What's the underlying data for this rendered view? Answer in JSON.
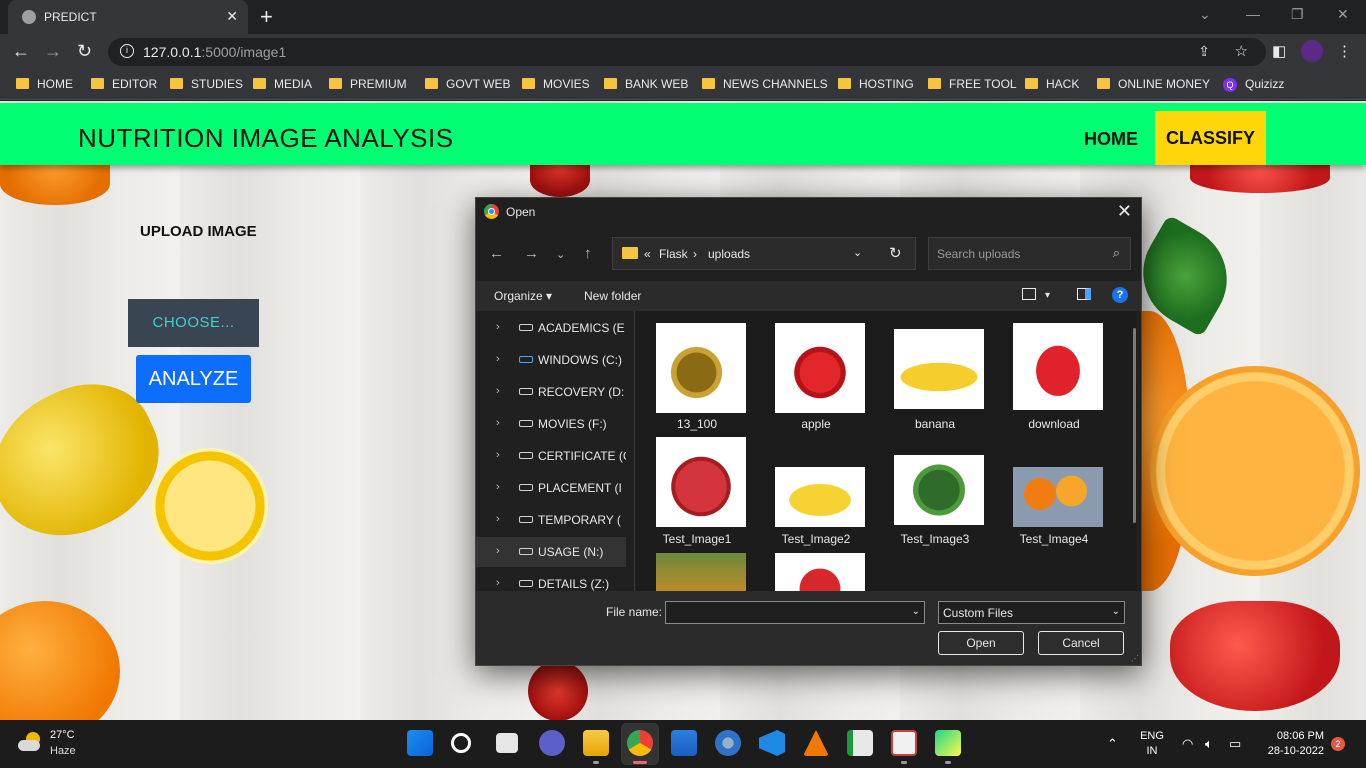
{
  "browser": {
    "tab_title": "PREDICT",
    "tab_close": "✕",
    "new_tab": "+",
    "url_host": "127.0.0.1",
    "url_path": ":5000/image1",
    "info_glyph": "i",
    "bookmarks": [
      "HOME",
      "EDITOR",
      "STUDIES",
      "MEDIA",
      "PREMIUM",
      "GOVT WEB",
      "MOVIES",
      "BANK WEB",
      "NEWS CHANNELS",
      "HOSTING",
      "FREE TOOL",
      "HACK",
      "ONLINE MONEY",
      "Quizizz"
    ],
    "quizizz_glyph": "Q"
  },
  "page": {
    "brand": "NUTRITION IMAGE ANALYSIS",
    "nav_home": "HOME",
    "nav_classify": "CLASSIFY",
    "nav_classify_color": "#ffd60a",
    "navbar_color": "#00ff73",
    "upload_label": "UPLOAD IMAGE",
    "choose_label": "CHOOSE...",
    "analyze_label": "ANALYZE"
  },
  "dialog": {
    "title": "Open",
    "close_glyph": "✕",
    "breadcrumb": [
      "«",
      "Flask",
      "›",
      "uploads"
    ],
    "search_placeholder": "Search uploads",
    "organize_label": "Organize ▾",
    "new_folder_label": "New folder",
    "help_glyph": "?",
    "nav_items": [
      {
        "label": "ACADEMICS (E",
        "selected": false,
        "icon": "drive-icon"
      },
      {
        "label": "WINDOWS (C:)",
        "selected": false,
        "icon": "windows-drive-icon"
      },
      {
        "label": "RECOVERY (D:",
        "selected": false,
        "icon": "drive-icon"
      },
      {
        "label": "MOVIES (F:)",
        "selected": false,
        "icon": "drive-icon"
      },
      {
        "label": "CERTIFICATE (G",
        "selected": false,
        "icon": "drive-icon"
      },
      {
        "label": "PLACEMENT (I",
        "selected": false,
        "icon": "drive-icon"
      },
      {
        "label": "TEMPORARY (",
        "selected": false,
        "icon": "drive-icon"
      },
      {
        "label": "USAGE (N:)",
        "selected": true,
        "icon": "drive-icon"
      },
      {
        "label": "DETAILS (Z:)",
        "selected": false,
        "icon": "drive-icon"
      }
    ],
    "files": [
      "13_100",
      "apple",
      "banana",
      "download",
      "Test_Image1",
      "Test_Image2",
      "Test_Image3",
      "Test_Image4",
      "",
      ""
    ],
    "file_name_label": "File name:",
    "file_name_value": "",
    "file_type": "Custom Files",
    "open_label": "Open",
    "cancel_label": "Cancel"
  },
  "taskbar": {
    "temperature": "27°C",
    "condition": "Haze",
    "lang_line1": "ENG",
    "lang_line2": "IN",
    "time": "08:06 PM",
    "date": "28-10-2022",
    "notification_count": "2"
  }
}
